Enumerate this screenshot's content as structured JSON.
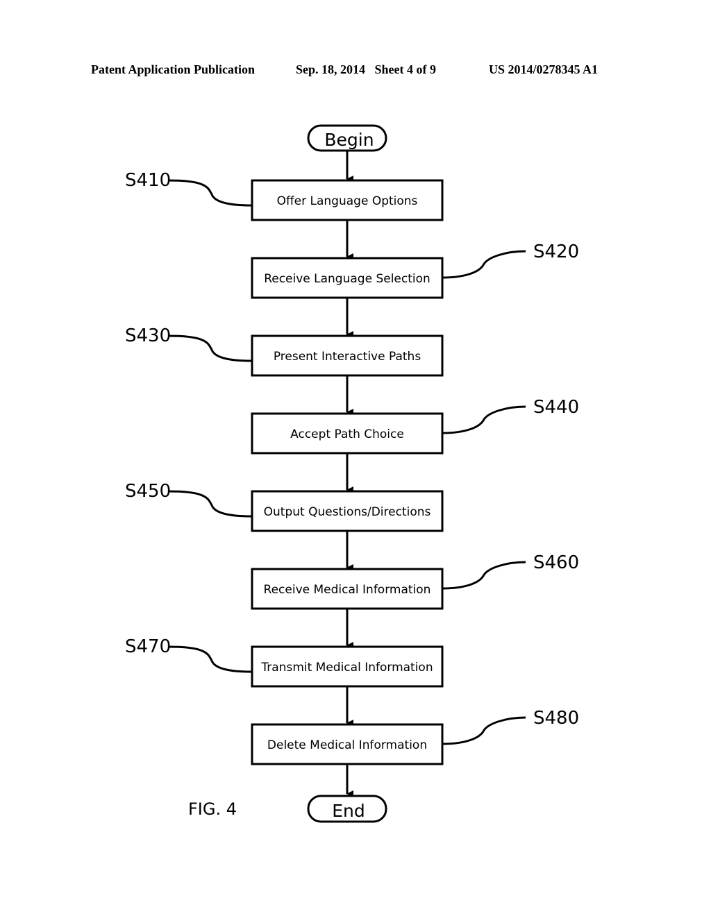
{
  "header": {
    "publication_type": "Patent Application Publication",
    "date_sheet": "Sep. 18, 2014   Sheet 4 of 9",
    "publication_number": "US 2014/0278345 A1"
  },
  "flowchart": {
    "start_label": "Begin",
    "end_label": "End",
    "figure_label": "FIG. 4",
    "steps": [
      {
        "ref": "S410",
        "label": "Offer Language Options",
        "ref_side": "left"
      },
      {
        "ref": "S420",
        "label": "Receive Language Selection",
        "ref_side": "right"
      },
      {
        "ref": "S430",
        "label": "Present Interactive Paths",
        "ref_side": "left"
      },
      {
        "ref": "S440",
        "label": "Accept Path Choice",
        "ref_side": "right"
      },
      {
        "ref": "S450",
        "label": "Output Questions/Directions",
        "ref_side": "left"
      },
      {
        "ref": "S460",
        "label": "Receive Medical Information",
        "ref_side": "right"
      },
      {
        "ref": "S470",
        "label": "Transmit Medical Information",
        "ref_side": "left"
      },
      {
        "ref": "S480",
        "label": "Delete Medical Information",
        "ref_side": "right"
      }
    ]
  }
}
